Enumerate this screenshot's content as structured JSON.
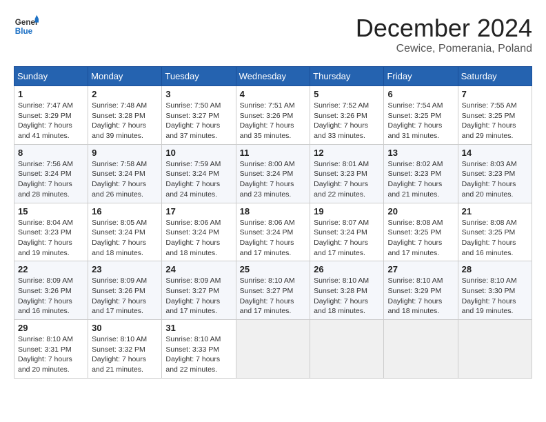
{
  "header": {
    "logo_general": "General",
    "logo_blue": "Blue",
    "month_title": "December 2024",
    "location": "Cewice, Pomerania, Poland"
  },
  "weekdays": [
    "Sunday",
    "Monday",
    "Tuesday",
    "Wednesday",
    "Thursday",
    "Friday",
    "Saturday"
  ],
  "weeks": [
    [
      {
        "day": "1",
        "sunrise": "Sunrise: 7:47 AM",
        "sunset": "Sunset: 3:29 PM",
        "daylight": "Daylight: 7 hours and 41 minutes."
      },
      {
        "day": "2",
        "sunrise": "Sunrise: 7:48 AM",
        "sunset": "Sunset: 3:28 PM",
        "daylight": "Daylight: 7 hours and 39 minutes."
      },
      {
        "day": "3",
        "sunrise": "Sunrise: 7:50 AM",
        "sunset": "Sunset: 3:27 PM",
        "daylight": "Daylight: 7 hours and 37 minutes."
      },
      {
        "day": "4",
        "sunrise": "Sunrise: 7:51 AM",
        "sunset": "Sunset: 3:26 PM",
        "daylight": "Daylight: 7 hours and 35 minutes."
      },
      {
        "day": "5",
        "sunrise": "Sunrise: 7:52 AM",
        "sunset": "Sunset: 3:26 PM",
        "daylight": "Daylight: 7 hours and 33 minutes."
      },
      {
        "day": "6",
        "sunrise": "Sunrise: 7:54 AM",
        "sunset": "Sunset: 3:25 PM",
        "daylight": "Daylight: 7 hours and 31 minutes."
      },
      {
        "day": "7",
        "sunrise": "Sunrise: 7:55 AM",
        "sunset": "Sunset: 3:25 PM",
        "daylight": "Daylight: 7 hours and 29 minutes."
      }
    ],
    [
      {
        "day": "8",
        "sunrise": "Sunrise: 7:56 AM",
        "sunset": "Sunset: 3:24 PM",
        "daylight": "Daylight: 7 hours and 28 minutes."
      },
      {
        "day": "9",
        "sunrise": "Sunrise: 7:58 AM",
        "sunset": "Sunset: 3:24 PM",
        "daylight": "Daylight: 7 hours and 26 minutes."
      },
      {
        "day": "10",
        "sunrise": "Sunrise: 7:59 AM",
        "sunset": "Sunset: 3:24 PM",
        "daylight": "Daylight: 7 hours and 24 minutes."
      },
      {
        "day": "11",
        "sunrise": "Sunrise: 8:00 AM",
        "sunset": "Sunset: 3:24 PM",
        "daylight": "Daylight: 7 hours and 23 minutes."
      },
      {
        "day": "12",
        "sunrise": "Sunrise: 8:01 AM",
        "sunset": "Sunset: 3:23 PM",
        "daylight": "Daylight: 7 hours and 22 minutes."
      },
      {
        "day": "13",
        "sunrise": "Sunrise: 8:02 AM",
        "sunset": "Sunset: 3:23 PM",
        "daylight": "Daylight: 7 hours and 21 minutes."
      },
      {
        "day": "14",
        "sunrise": "Sunrise: 8:03 AM",
        "sunset": "Sunset: 3:23 PM",
        "daylight": "Daylight: 7 hours and 20 minutes."
      }
    ],
    [
      {
        "day": "15",
        "sunrise": "Sunrise: 8:04 AM",
        "sunset": "Sunset: 3:23 PM",
        "daylight": "Daylight: 7 hours and 19 minutes."
      },
      {
        "day": "16",
        "sunrise": "Sunrise: 8:05 AM",
        "sunset": "Sunset: 3:24 PM",
        "daylight": "Daylight: 7 hours and 18 minutes."
      },
      {
        "day": "17",
        "sunrise": "Sunrise: 8:06 AM",
        "sunset": "Sunset: 3:24 PM",
        "daylight": "Daylight: 7 hours and 18 minutes."
      },
      {
        "day": "18",
        "sunrise": "Sunrise: 8:06 AM",
        "sunset": "Sunset: 3:24 PM",
        "daylight": "Daylight: 7 hours and 17 minutes."
      },
      {
        "day": "19",
        "sunrise": "Sunrise: 8:07 AM",
        "sunset": "Sunset: 3:24 PM",
        "daylight": "Daylight: 7 hours and 17 minutes."
      },
      {
        "day": "20",
        "sunrise": "Sunrise: 8:08 AM",
        "sunset": "Sunset: 3:25 PM",
        "daylight": "Daylight: 7 hours and 17 minutes."
      },
      {
        "day": "21",
        "sunrise": "Sunrise: 8:08 AM",
        "sunset": "Sunset: 3:25 PM",
        "daylight": "Daylight: 7 hours and 16 minutes."
      }
    ],
    [
      {
        "day": "22",
        "sunrise": "Sunrise: 8:09 AM",
        "sunset": "Sunset: 3:26 PM",
        "daylight": "Daylight: 7 hours and 16 minutes."
      },
      {
        "day": "23",
        "sunrise": "Sunrise: 8:09 AM",
        "sunset": "Sunset: 3:26 PM",
        "daylight": "Daylight: 7 hours and 17 minutes."
      },
      {
        "day": "24",
        "sunrise": "Sunrise: 8:09 AM",
        "sunset": "Sunset: 3:27 PM",
        "daylight": "Daylight: 7 hours and 17 minutes."
      },
      {
        "day": "25",
        "sunrise": "Sunrise: 8:10 AM",
        "sunset": "Sunset: 3:27 PM",
        "daylight": "Daylight: 7 hours and 17 minutes."
      },
      {
        "day": "26",
        "sunrise": "Sunrise: 8:10 AM",
        "sunset": "Sunset: 3:28 PM",
        "daylight": "Daylight: 7 hours and 18 minutes."
      },
      {
        "day": "27",
        "sunrise": "Sunrise: 8:10 AM",
        "sunset": "Sunset: 3:29 PM",
        "daylight": "Daylight: 7 hours and 18 minutes."
      },
      {
        "day": "28",
        "sunrise": "Sunrise: 8:10 AM",
        "sunset": "Sunset: 3:30 PM",
        "daylight": "Daylight: 7 hours and 19 minutes."
      }
    ],
    [
      {
        "day": "29",
        "sunrise": "Sunrise: 8:10 AM",
        "sunset": "Sunset: 3:31 PM",
        "daylight": "Daylight: 7 hours and 20 minutes."
      },
      {
        "day": "30",
        "sunrise": "Sunrise: 8:10 AM",
        "sunset": "Sunset: 3:32 PM",
        "daylight": "Daylight: 7 hours and 21 minutes."
      },
      {
        "day": "31",
        "sunrise": "Sunrise: 8:10 AM",
        "sunset": "Sunset: 3:33 PM",
        "daylight": "Daylight: 7 hours and 22 minutes."
      },
      null,
      null,
      null,
      null
    ]
  ]
}
